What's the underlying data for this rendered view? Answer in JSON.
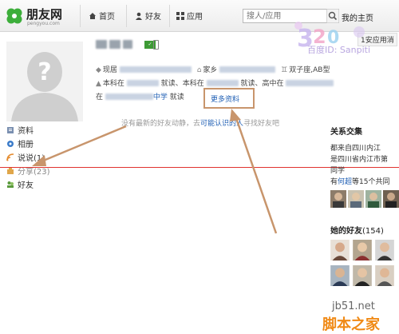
{
  "topbar": {
    "brand": "朋友网",
    "brand_sub": "pengyou.com",
    "nav": [
      {
        "label": "首页",
        "icon": "home-icon"
      },
      {
        "label": "好友",
        "icon": "person-icon"
      },
      {
        "label": "应用",
        "icon": "grid-icon"
      }
    ],
    "search_placeholder": "搜人/应用",
    "right_link": "我的主页",
    "app_link": "1安应用消"
  },
  "watermark": {
    "text": "百度ID: Sanpiti"
  },
  "profile": {
    "location_label": "现居",
    "hometown_label": "家乡",
    "zodiac": "双子座,AB型",
    "edu_line1_parts": [
      "本科在",
      "就读、本科在",
      "就读、高中在"
    ],
    "edu_line2_prefix": "在",
    "edu_line2_school": "中学",
    "edu_line2_suffix": "就读",
    "more_info": "更多资料"
  },
  "news": {
    "prefix": "没有最新的好友动静，去",
    "link": "可能认识的人",
    "suffix": "寻找好友吧"
  },
  "side_nav": [
    {
      "label": "资料",
      "icon": "profile-icon"
    },
    {
      "label": "相册",
      "icon": "album-icon"
    },
    {
      "label": "说说(1)",
      "icon": "talk-icon"
    },
    {
      "label": "分享(23)",
      "icon": "share-icon"
    },
    {
      "label": "好友",
      "icon": "friends-icon"
    }
  ],
  "relations": {
    "title": "关系交集",
    "line1": "都来自四川内江",
    "line2": "是四川省内江市第",
    "line3": "同学",
    "line4_prefix": "有",
    "line4_link": "何超",
    "line4_suffix": "等15个共同"
  },
  "friends": {
    "title": "她的好友",
    "count": "(154)"
  },
  "site_watermark": {
    "domain": "jb51.net",
    "name": "脚本之家"
  },
  "colors": {
    "link": "#1f5fb4",
    "arrow": "#c8956c",
    "red_line": "#e0342f",
    "brand_green": "#3d9a35"
  }
}
